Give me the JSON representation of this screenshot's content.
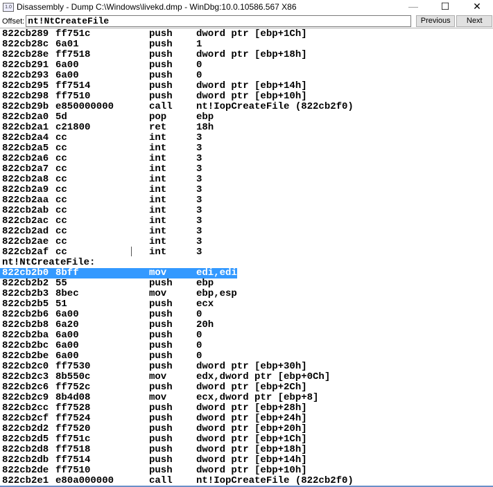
{
  "window": {
    "title": "Disassembly - Dump C:\\Windows\\livekd.dmp - WinDbg:10.0.10586.567 X86",
    "icon_text": "1.0",
    "minimize": "—",
    "maximize": "☐",
    "close": "✕"
  },
  "offset": {
    "label": "Offset:",
    "value": "nt!NtCreateFile",
    "previous": "Previous",
    "next": "Next"
  },
  "lines": [
    {
      "addr": "822cb289",
      "bytes": "ff751c",
      "mn": "push",
      "op": "dword ptr [ebp+1Ch]"
    },
    {
      "addr": "822cb28c",
      "bytes": "6a01",
      "mn": "push",
      "op": "1"
    },
    {
      "addr": "822cb28e",
      "bytes": "ff7518",
      "mn": "push",
      "op": "dword ptr [ebp+18h]"
    },
    {
      "addr": "822cb291",
      "bytes": "6a00",
      "mn": "push",
      "op": "0"
    },
    {
      "addr": "822cb293",
      "bytes": "6a00",
      "mn": "push",
      "op": "0"
    },
    {
      "addr": "822cb295",
      "bytes": "ff7514",
      "mn": "push",
      "op": "dword ptr [ebp+14h]"
    },
    {
      "addr": "822cb298",
      "bytes": "ff7510",
      "mn": "push",
      "op": "dword ptr [ebp+10h]"
    },
    {
      "addr": "822cb29b",
      "bytes": "e850000000",
      "mn": "call",
      "op": "nt!IopCreateFile (822cb2f0)"
    },
    {
      "addr": "822cb2a0",
      "bytes": "5d",
      "mn": "pop",
      "op": "ebp"
    },
    {
      "addr": "822cb2a1",
      "bytes": "c21800",
      "mn": "ret",
      "op": "18h"
    },
    {
      "addr": "822cb2a4",
      "bytes": "cc",
      "mn": "int",
      "op": "3"
    },
    {
      "addr": "822cb2a5",
      "bytes": "cc",
      "mn": "int",
      "op": "3"
    },
    {
      "addr": "822cb2a6",
      "bytes": "cc",
      "mn": "int",
      "op": "3"
    },
    {
      "addr": "822cb2a7",
      "bytes": "cc",
      "mn": "int",
      "op": "3"
    },
    {
      "addr": "822cb2a8",
      "bytes": "cc",
      "mn": "int",
      "op": "3"
    },
    {
      "addr": "822cb2a9",
      "bytes": "cc",
      "mn": "int",
      "op": "3"
    },
    {
      "addr": "822cb2aa",
      "bytes": "cc",
      "mn": "int",
      "op": "3"
    },
    {
      "addr": "822cb2ab",
      "bytes": "cc",
      "mn": "int",
      "op": "3"
    },
    {
      "addr": "822cb2ac",
      "bytes": "cc",
      "mn": "int",
      "op": "3"
    },
    {
      "addr": "822cb2ad",
      "bytes": "cc",
      "mn": "int",
      "op": "3"
    },
    {
      "addr": "822cb2ae",
      "bytes": "cc",
      "mn": "int",
      "op": "3"
    },
    {
      "addr": "822cb2af",
      "bytes": "cc",
      "mn": "int",
      "op": "3"
    },
    {
      "label": "nt!NtCreateFile:"
    },
    {
      "addr": "822cb2b0",
      "bytes": "8bff",
      "mn": "mov",
      "op": "edi,edi",
      "selected": true
    },
    {
      "addr": "822cb2b2",
      "bytes": "55",
      "mn": "push",
      "op": "ebp"
    },
    {
      "addr": "822cb2b3",
      "bytes": "8bec",
      "mn": "mov",
      "op": "ebp,esp"
    },
    {
      "addr": "822cb2b5",
      "bytes": "51",
      "mn": "push",
      "op": "ecx"
    },
    {
      "addr": "822cb2b6",
      "bytes": "6a00",
      "mn": "push",
      "op": "0"
    },
    {
      "addr": "822cb2b8",
      "bytes": "6a20",
      "mn": "push",
      "op": "20h"
    },
    {
      "addr": "822cb2ba",
      "bytes": "6a00",
      "mn": "push",
      "op": "0"
    },
    {
      "addr": "822cb2bc",
      "bytes": "6a00",
      "mn": "push",
      "op": "0"
    },
    {
      "addr": "822cb2be",
      "bytes": "6a00",
      "mn": "push",
      "op": "0"
    },
    {
      "addr": "822cb2c0",
      "bytes": "ff7530",
      "mn": "push",
      "op": "dword ptr [ebp+30h]"
    },
    {
      "addr": "822cb2c3",
      "bytes": "8b550c",
      "mn": "mov",
      "op": "edx,dword ptr [ebp+0Ch]"
    },
    {
      "addr": "822cb2c6",
      "bytes": "ff752c",
      "mn": "push",
      "op": "dword ptr [ebp+2Ch]"
    },
    {
      "addr": "822cb2c9",
      "bytes": "8b4d08",
      "mn": "mov",
      "op": "ecx,dword ptr [ebp+8]"
    },
    {
      "addr": "822cb2cc",
      "bytes": "ff7528",
      "mn": "push",
      "op": "dword ptr [ebp+28h]"
    },
    {
      "addr": "822cb2cf",
      "bytes": "ff7524",
      "mn": "push",
      "op": "dword ptr [ebp+24h]"
    },
    {
      "addr": "822cb2d2",
      "bytes": "ff7520",
      "mn": "push",
      "op": "dword ptr [ebp+20h]"
    },
    {
      "addr": "822cb2d5",
      "bytes": "ff751c",
      "mn": "push",
      "op": "dword ptr [ebp+1Ch]"
    },
    {
      "addr": "822cb2d8",
      "bytes": "ff7518",
      "mn": "push",
      "op": "dword ptr [ebp+18h]"
    },
    {
      "addr": "822cb2db",
      "bytes": "ff7514",
      "mn": "push",
      "op": "dword ptr [ebp+14h]"
    },
    {
      "addr": "822cb2de",
      "bytes": "ff7510",
      "mn": "push",
      "op": "dword ptr [ebp+10h]"
    },
    {
      "addr": "822cb2e1",
      "bytes": "e80a000000",
      "mn": "call",
      "op": "nt!IopCreateFile (822cb2f0)"
    }
  ]
}
